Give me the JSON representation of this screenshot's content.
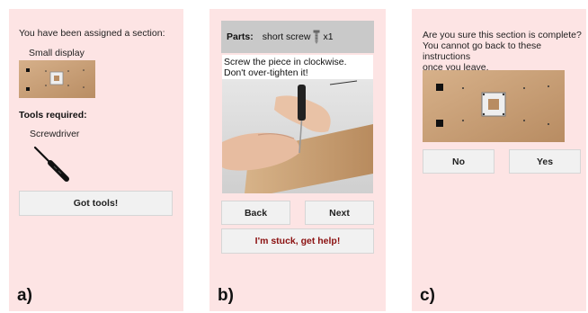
{
  "panel_a": {
    "heading": "You have been assigned a section:",
    "section_name": "Small display",
    "tools_heading": "Tools required:",
    "tool_name": "Screwdriver",
    "got_tools_label": "Got tools!",
    "letter": "a)"
  },
  "panel_b": {
    "parts_label": "Parts:",
    "part_name": "short screw",
    "part_qty": "x1",
    "instruction_line1": "Screw the piece in clockwise.",
    "instruction_line2": "Don't over-tighten it!",
    "back_label": "Back",
    "next_label": "Next",
    "stuck_label": "I'm stuck, get help!",
    "letter": "b)"
  },
  "panel_c": {
    "question_line1": "Are you sure this section is complete?",
    "question_line2": "You cannot go back to these instructions",
    "question_line3": "once you leave.",
    "no_label": "No",
    "yes_label": "Yes",
    "letter": "c)"
  },
  "colors": {
    "panel_bg": "#fde4e4",
    "button_bg": "#f1f1f1",
    "parts_bar_bg": "#c9c9c9",
    "stuck_text": "#8b1010",
    "wood": "#c9a27a"
  },
  "icons": {
    "screwdriver": "screwdriver-icon",
    "screw": "screw-icon"
  }
}
